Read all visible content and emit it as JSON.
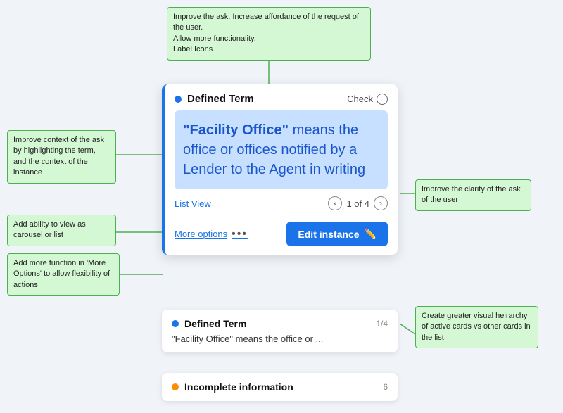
{
  "annotations": {
    "top": {
      "text": "Improve the ask. Increase affordance of the request of the user.\nAllow more functionality.\nLabel Icons"
    },
    "left1": {
      "text": "Improve context of the ask by highlighting the term, and the context of the instance"
    },
    "left2": {
      "text": "Add ability to view as carousel or list"
    },
    "left3": {
      "text": "Add more function in 'More Options' to allow flexibility of actions"
    },
    "right1": {
      "text": "Improve the clarity of the ask of the user"
    },
    "right2": {
      "text": "Create greater visual heirarchy of active cards vs other cards in the list"
    }
  },
  "main_card": {
    "dot_color": "#1a73e8",
    "title": "Defined Term",
    "check_label": "Check",
    "content_quote": "\"Facility Office\"",
    "content_rest": " means the office or offices notified by a Lender to the Agent in writing",
    "list_view_label": "List View",
    "pagination": "1 of 4",
    "more_options_label": "More options",
    "edit_button_label": "Edit instance"
  },
  "secondary_card": {
    "title": "Defined Term",
    "badge": "1/4",
    "text": "\"Facility Office\" means the office or ..."
  },
  "third_card": {
    "title": "Incomplete information",
    "badge": "6"
  }
}
